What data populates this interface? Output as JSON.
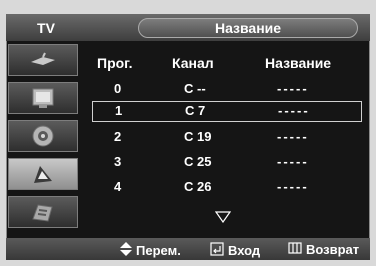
{
  "header": {
    "source_label": "TV",
    "title": "Название"
  },
  "columns": {
    "prog": "Прог.",
    "channel": "Канал",
    "name": "Название"
  },
  "rows": [
    {
      "prog": "0",
      "channel": "C --",
      "name": "-----",
      "selected": false
    },
    {
      "prog": "1",
      "channel": "C 7",
      "name": "-----",
      "selected": true
    },
    {
      "prog": "2",
      "channel": "C 19",
      "name": "-----",
      "selected": false
    },
    {
      "prog": "3",
      "channel": "C 25",
      "name": "-----",
      "selected": false
    },
    {
      "prog": "4",
      "channel": "C 26",
      "name": "-----",
      "selected": false
    }
  ],
  "sidebar": {
    "items": [
      {
        "icon": "antenna-icon",
        "active": false
      },
      {
        "icon": "picture-icon",
        "active": false
      },
      {
        "icon": "speaker-icon",
        "active": false
      },
      {
        "icon": "channel-icon",
        "active": true
      },
      {
        "icon": "setup-icon",
        "active": false
      }
    ]
  },
  "footer": {
    "move_label": "Перем.",
    "enter_label": "Вход",
    "return_label": "Возврат"
  }
}
